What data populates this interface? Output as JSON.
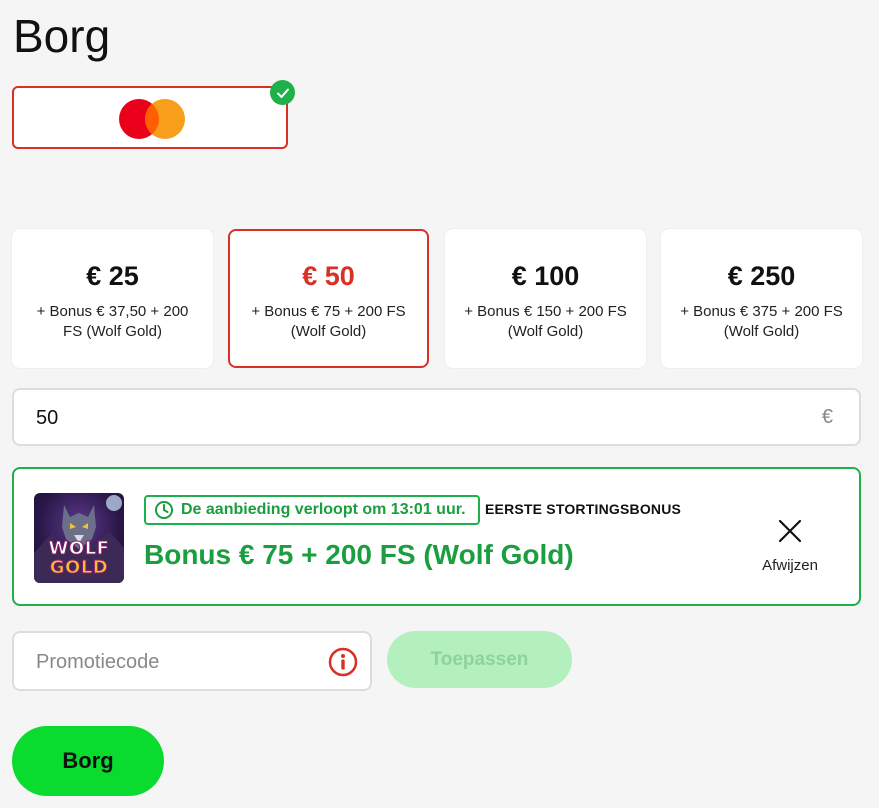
{
  "page": {
    "title": "Borg"
  },
  "payment_method": {
    "name": "mastercard",
    "selected": true,
    "icon": "check-icon"
  },
  "amount_options": [
    {
      "value": "€ 25",
      "bonus": "+ Bonus € 37,50 + 200 FS (Wolf Gold)",
      "selected": false
    },
    {
      "value": "€ 50",
      "bonus": "+ Bonus € 75 + 200 FS (Wolf Gold)",
      "selected": true
    },
    {
      "value": "€ 100",
      "bonus": "+ Bonus € 150 + 200 FS (Wolf Gold)",
      "selected": false
    },
    {
      "value": "€ 250",
      "bonus": "+ Bonus € 375 + 200 FS (Wolf Gold)",
      "selected": false
    }
  ],
  "amount_input": {
    "value": "50",
    "currency": "€"
  },
  "bonus_offer": {
    "game_logo_text": [
      "WOLF",
      "GOLD"
    ],
    "timer_text": "De aanbieding verloopt om 13:01 uur.",
    "label": "EERSTE STORTINGSBONUS",
    "title": "Bonus € 75 + 200 FS (Wolf Gold)",
    "dismiss_label": "Afwijzen"
  },
  "promo": {
    "placeholder": "Promotiecode",
    "apply_label": "Toepassen"
  },
  "submit": {
    "label": "Borg"
  },
  "colors": {
    "accent_red": "#d93025",
    "accent_green": "#1eb04a",
    "submit_green": "#0adc2f",
    "apply_disabled": "#b3f0bd",
    "mastercard_red": "#eb001b",
    "mastercard_orange": "#f79e1b"
  }
}
